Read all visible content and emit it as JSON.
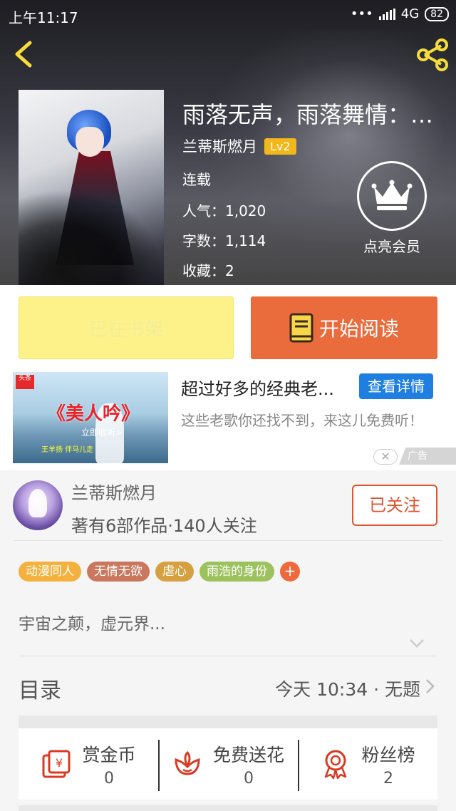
{
  "status_bar": {
    "time": "上午11:17",
    "network": "4G",
    "battery": "82"
  },
  "book": {
    "title": "雨落无声，雨落舞情：灭...",
    "author": "兰蒂斯燃月",
    "level": "Lv2",
    "status": "连载",
    "popularity_label": "人气：",
    "popularity": "1,020",
    "words_label": "字数：",
    "words": "1,114",
    "favorites_label": "收藏：",
    "favorites": "2"
  },
  "vip": {
    "label": "点亮会员"
  },
  "actions": {
    "shelf_label": "已在书架",
    "read_label": "开始阅读"
  },
  "ad": {
    "image_title": "《美人吟》",
    "image_sub": "立即收听>",
    "image_caption": "王羊扬 伴马儿走",
    "image_logo": "头条",
    "title": "超过好多的经典老...",
    "cta": "查看详情",
    "description": "这些老歌你还找不到，来这儿免费听！",
    "close": "✕",
    "tag": "广告"
  },
  "author_card": {
    "name": "兰蒂斯燃月",
    "stats": "著有6部作品·140人关注",
    "follow_label": "已关注"
  },
  "tags": [
    {
      "label": "动漫同人",
      "color": "#f4b13e"
    },
    {
      "label": "无情无欲",
      "color": "#c9785e"
    },
    {
      "label": "虐心",
      "color": "#d6a040"
    },
    {
      "label": "雨浩的身份",
      "color": "#9cc25d"
    }
  ],
  "tag_add": "+",
  "intro": "宇宙之颠，虚元界...",
  "toc": {
    "label": "目录",
    "latest": "今天 10:34 · 无题"
  },
  "stats": [
    {
      "label": "赏金币",
      "value": "0",
      "icon": "reward-coin-icon"
    },
    {
      "label": "免费送花",
      "value": "0",
      "icon": "flower-icon"
    },
    {
      "label": "粉丝榜",
      "value": "2",
      "icon": "medal-icon"
    }
  ],
  "colors": {
    "accent_orange": "#ea6b3c",
    "shelf_yellow": "#fdf28a",
    "lv_gold": "#f2b71a",
    "icon_red": "#d83a22"
  }
}
